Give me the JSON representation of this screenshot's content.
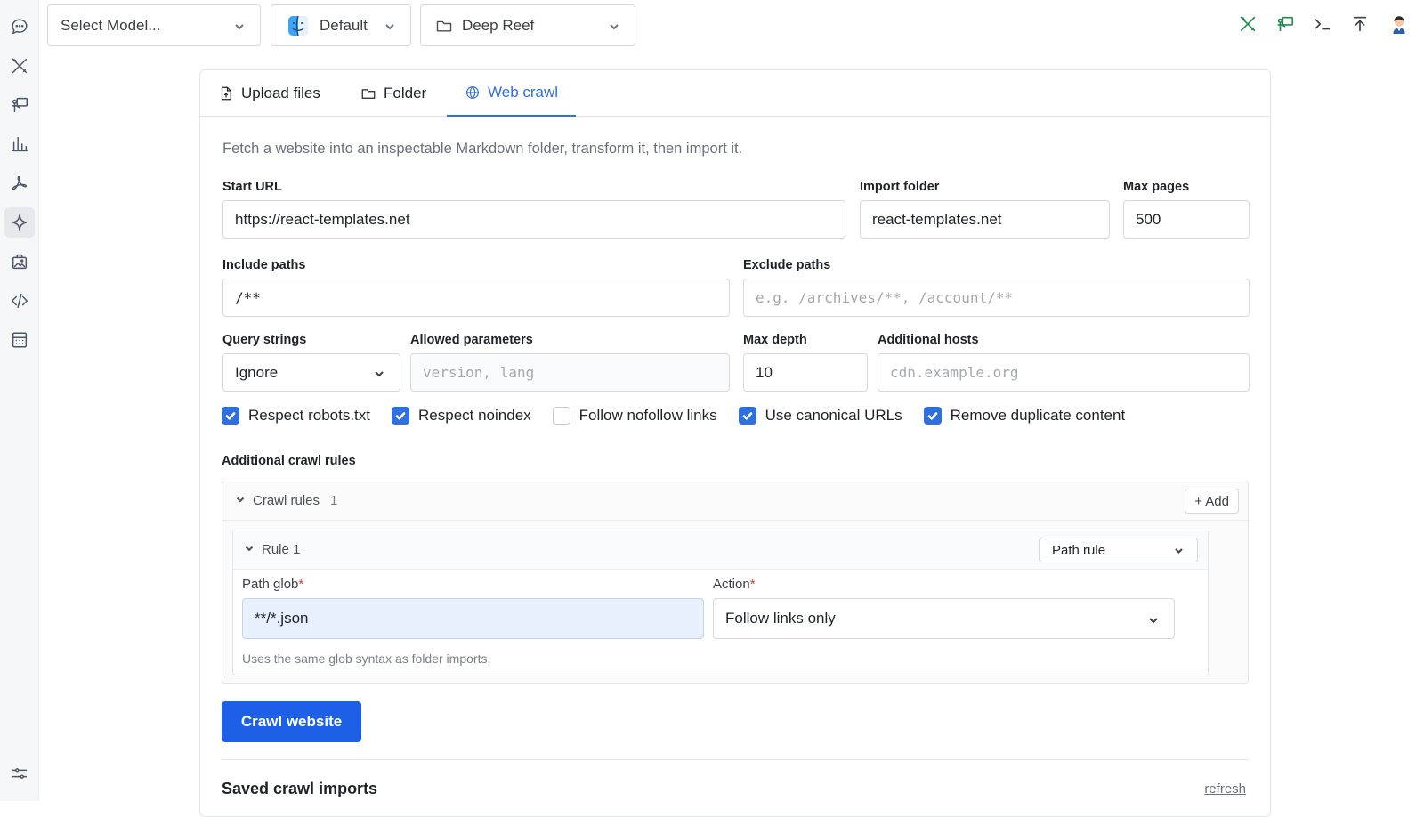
{
  "toolbar": {
    "model_select": "Select Model...",
    "profile_select": "Default",
    "workspace_select": "Deep Reef"
  },
  "tabs": [
    {
      "label": "Upload files",
      "icon": "file-upload-icon"
    },
    {
      "label": "Folder",
      "icon": "folder-icon"
    },
    {
      "label": "Web crawl",
      "icon": "globe-icon",
      "active": true
    }
  ],
  "form": {
    "description": "Fetch a website into an inspectable Markdown folder, transform it, then import it.",
    "start_url": {
      "label": "Start URL",
      "value": "https://react-templates.net"
    },
    "import_folder": {
      "label": "Import folder",
      "value": "react-templates.net"
    },
    "max_pages": {
      "label": "Max pages",
      "value": "500"
    },
    "include_paths": {
      "label": "Include paths",
      "value": "/**"
    },
    "exclude_paths": {
      "label": "Exclude paths",
      "placeholder": "e.g. /archives/**, /account/**"
    },
    "query_strings": {
      "label": "Query strings",
      "value": "Ignore"
    },
    "allowed_parameters": {
      "label": "Allowed parameters",
      "placeholder": "version, lang"
    },
    "max_depth": {
      "label": "Max depth",
      "value": "10"
    },
    "additional_hosts": {
      "label": "Additional hosts",
      "placeholder": "cdn.example.org"
    },
    "checkboxes": [
      {
        "label": "Respect robots.txt",
        "checked": true
      },
      {
        "label": "Respect noindex",
        "checked": true
      },
      {
        "label": "Follow nofollow links",
        "checked": false
      },
      {
        "label": "Use canonical URLs",
        "checked": true
      },
      {
        "label": "Remove duplicate content",
        "checked": true
      }
    ],
    "additional_rules_label": "Additional crawl rules",
    "rules": {
      "header": "Crawl rules",
      "count": "1",
      "add_label": "+ Add",
      "rule": {
        "title": "Rule 1",
        "type": "Path rule",
        "path_glob_label": "Path glob",
        "path_glob_value": "**/*.json",
        "action_label": "Action",
        "action_value": "Follow links only",
        "required_mark": "*",
        "hint": "Uses the same glob syntax as folder imports."
      }
    },
    "submit_label": "Crawl website"
  },
  "saved": {
    "title": "Saved crawl imports",
    "refresh_label": "refresh"
  },
  "colors": {
    "accent": "#2f6fde",
    "primary_button": "#1d5fe6",
    "toolbar_green": "#1f8a4c"
  }
}
